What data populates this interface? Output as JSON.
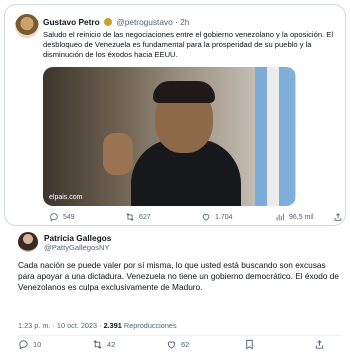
{
  "quoted": {
    "name": "Gustavo Petro",
    "handle": "@petrogustavo",
    "time": "2h",
    "text": "Saludo el reinicio de las negociaciones entre el gobierno venezolano y la oposición. El desbloqueo de Venezuela es fundamental para la prosperidad de su pueblo y la disminución de los éxodos hacia EEUU.",
    "image_source": "elpais.com",
    "stats": {
      "replies": "549",
      "retweets": "627",
      "likes": "1.704",
      "views": "96,5 mil"
    }
  },
  "tweet": {
    "name": "Patricia Gallegos",
    "handle": "@PattyGallegosNY",
    "text": "Cada nación se puede valer por sí misma, lo que usted está buscando son excusas para apoyar a una dictadura. Venezuela no tiene un gobierno democrático. El éxodo de Venezolanos es culpa exclusivamente de Maduro.",
    "time": "1:23 p. m. · 10 oct. 2023 ·",
    "views_count": "2.391",
    "views_label": "Reproducciones",
    "stats": {
      "replies": "10",
      "retweets": "42",
      "likes": "62"
    }
  }
}
